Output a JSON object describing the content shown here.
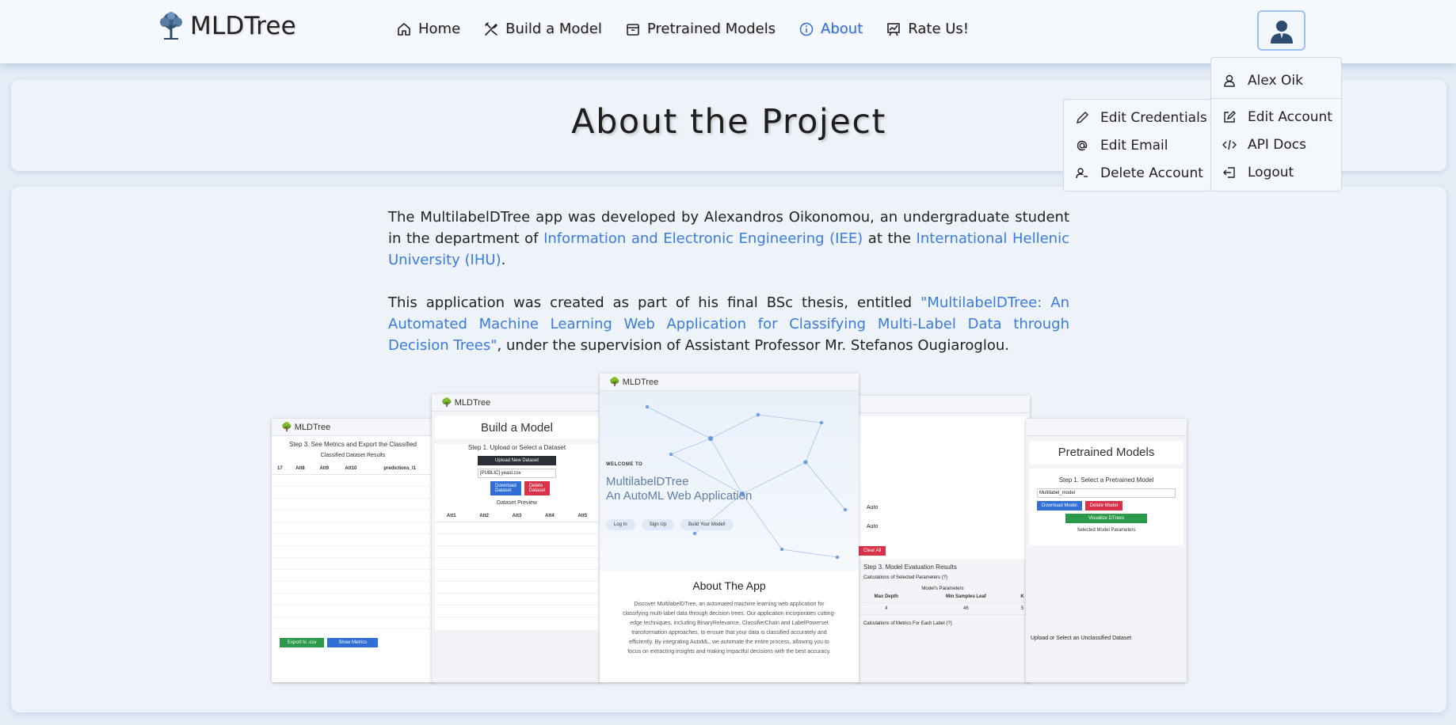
{
  "brand": {
    "name": "MLDTree"
  },
  "nav": {
    "items": [
      {
        "label": "Home",
        "icon": "home-icon"
      },
      {
        "label": "Build a Model",
        "icon": "tools-icon"
      },
      {
        "label": "Pretrained Models",
        "icon": "box-icon"
      },
      {
        "label": "About",
        "icon": "info-icon",
        "active": true
      },
      {
        "label": "Rate Us!",
        "icon": "chart-icon"
      }
    ],
    "active_color": "#2f6fd6"
  },
  "user_menu": {
    "user_name": "Alex Oik",
    "items": [
      {
        "label": "Edit Account",
        "icon": "edit-icon"
      },
      {
        "label": "API Docs",
        "icon": "code-icon"
      },
      {
        "label": "Logout",
        "icon": "logout-icon"
      }
    ],
    "submenu": [
      {
        "label": "Edit Credentials",
        "icon": "pencil-icon"
      },
      {
        "label": "Edit Email",
        "icon": "at-icon"
      },
      {
        "label": "Delete Account",
        "icon": "user-minus-icon"
      }
    ]
  },
  "page": {
    "title": "About the Project",
    "p1": {
      "t1": "The MultilabelDTree app was developed by Alexandros Oikonomou, an undergraduate student in the department of ",
      "link1": "Information and Electronic Engineering (IEE)",
      "t2": " at the ",
      "link2": "International Hellenic University (IHU)",
      "t3": "."
    },
    "p2": {
      "t1": "This application was created as part of his final BSc thesis, entitled ",
      "link1": "\"MultilabelDTree: An Automated Machine Learning Web Application for Classifying Multi-Label Data through Decision Trees\"",
      "t2": ", under the supervision of Assistant Professor Mr. Stefanos Ougiaroglou."
    },
    "link_color": "#3a7be0"
  },
  "collage": {
    "brand": "MLDTree",
    "shot1": {
      "step": "Step 3. See Metrics and Export the Classified",
      "sub": "Classified Dataset Results",
      "headers": [
        "17",
        "Att8",
        "Att9",
        "Att10",
        "predictions_l1"
      ],
      "btn_export": "Export to .csv",
      "btn_metrics": "Show Metrics"
    },
    "shot2": {
      "heading": "Build a Model",
      "step": "Step 1. Upload or Select a Dataset",
      "upload": "Upload New Dataset",
      "select_value": "[PUBLIC] yeast.csv",
      "btn_download": "Download Dataset",
      "btn_delete": "Delete Dataset",
      "preview": "Dataset Preview",
      "headers": [
        "Att1",
        "Att2",
        "Att3",
        "Att4",
        "Att5"
      ]
    },
    "shot3": {
      "welcome": "WELCOME TO",
      "title1": "MultilabelDTree",
      "title2": "An AutoML Web Application",
      "btn_login": "Log In",
      "btn_signup": "Sign Up",
      "btn_build": "Build Your Model!",
      "about_title": "About The App",
      "about_text": "Discover MultilabelDTree, an automated machine learning web application for classifying multi-label data through decision trees. Our application incorporates cutting-edge techniques, including BinaryRelevance, ClassifierChain and LabelPowerset transformation approaches, to ensure that your data is classified accurately and efficiently. By integrating AutoML, we automate the entire process, allowing you to focus on extracting insights and making impactful decisions with the best accuracy."
    },
    "shot4": {
      "auto1": "Auto",
      "auto2": "Auto",
      "clear": "Clear All",
      "step": "Step 3. Model Evaluation Results",
      "calc": "Calculations of Selected Parameters (?)",
      "params": "Model's Parameters",
      "col1": "Max Depth",
      "col2": "Min Samples Leaf",
      "col3": "K",
      "v1": "4",
      "v2": "46",
      "v3": "5",
      "metrics": "Calculations of Metrics For Each Label (?)"
    },
    "shot5": {
      "heading": "Pretrained Models",
      "step": "Step 1. Select a Pretrained Model",
      "select_value": "Multilabel_model",
      "btn_download": "Download Model",
      "btn_delete": "Delete Model",
      "btn_visualize": "Visualize DTrees",
      "params": "Selected Model Parameters",
      "step2": "Upload or Select an Unclassified Dataset"
    }
  }
}
